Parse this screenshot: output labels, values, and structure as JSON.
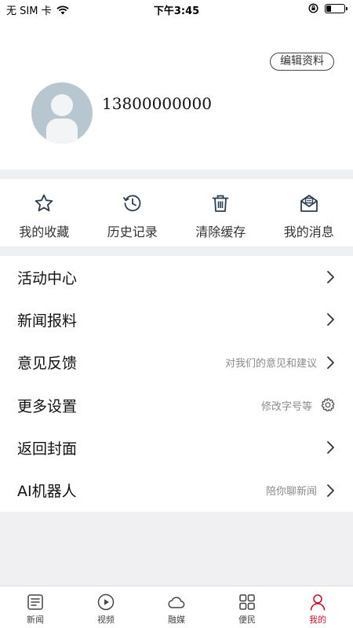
{
  "status_bar": {
    "carrier": "无 SIM 卡",
    "time": "下午3:45",
    "battery_level": 0.3
  },
  "profile": {
    "edit_label": "编辑资料",
    "phone": "13800000000"
  },
  "quick_actions": [
    {
      "label": "我的收藏",
      "icon": "star-icon"
    },
    {
      "label": "历史记录",
      "icon": "history-icon"
    },
    {
      "label": "清除缓存",
      "icon": "trash-icon"
    },
    {
      "label": "我的消息",
      "icon": "message-icon"
    }
  ],
  "menu": [
    {
      "label": "活动中心",
      "hint": "",
      "trailing": "chevron"
    },
    {
      "label": "新闻报料",
      "hint": "",
      "trailing": "chevron"
    },
    {
      "label": "意见反馈",
      "hint": "对我们的意见和建议",
      "trailing": "chevron"
    },
    {
      "label": "更多设置",
      "hint": "修改字号等",
      "trailing": "gear"
    },
    {
      "label": "返回封面",
      "hint": "",
      "trailing": "chevron"
    },
    {
      "label": "AI机器人",
      "hint": "陪你聊新闻",
      "trailing": "chevron"
    }
  ],
  "tabs": [
    {
      "label": "新闻",
      "icon": "news-icon",
      "active": false
    },
    {
      "label": "视频",
      "icon": "video-icon",
      "active": false
    },
    {
      "label": "融媒",
      "icon": "cloud-icon",
      "active": false
    },
    {
      "label": "便民",
      "icon": "grid-icon",
      "active": false
    },
    {
      "label": "我的",
      "icon": "person-icon",
      "active": true
    }
  ],
  "colors": {
    "accent": "#c0122c",
    "divider": "#eef1f4",
    "avatar_bg": "#b8c7cf"
  }
}
